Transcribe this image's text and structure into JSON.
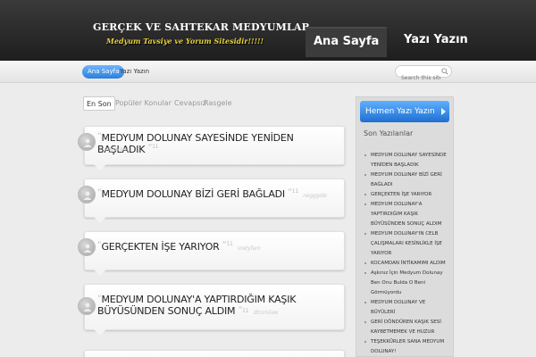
{
  "header": {
    "site_title": "GERÇEK VE SAHTEKAR MEDYUMLAR",
    "tagline": "Medyum Tavsiye ve Yorum Sitesidir!!!!!",
    "nav": [
      {
        "label": "Ana Sayfa",
        "active": true
      },
      {
        "label": "Yazı Yazın",
        "active": false
      }
    ]
  },
  "breadcrumb": {
    "home_label": "Ana Sayfa",
    "current_label": "Yazı Yazın"
  },
  "search": {
    "placeholder": "Search this site..."
  },
  "tabs": [
    {
      "label": "En Son",
      "active": true
    },
    {
      "label": "Popüler Konular",
      "active": false
    },
    {
      "label": "Cevapsız",
      "active": false
    },
    {
      "label": "Rasgele",
      "active": false
    }
  ],
  "posts": [
    {
      "title": "MEDYUM DOLUNAY SAYESİNDE YENİDEN BAŞLADIK",
      "count": "11",
      "author": "edevreet"
    },
    {
      "title": "MEDYUM DOLUNAY BİZİ GERİ BAĞLADI",
      "count": "11",
      "author": "negggide"
    },
    {
      "title": "GERÇEKTEN İŞE YARIYOR",
      "count": "11",
      "author": "vretyfam"
    },
    {
      "title_line1": "MEDYUM DOLUNAY'A YAPTIRDIĞIM KAŞIK",
      "title_line2": "BÜYÜSÜNDEN SONUÇ ALDIM",
      "count": "11",
      "author": "dtrsmilaw"
    }
  ],
  "sidebar": {
    "cta_label": "Hemen Yazı Yazın",
    "heading": "Son Yazılanlar",
    "recent": [
      [
        "MEDYUM DOLUNAY SAYESİNDE",
        "YENİDEN BAŞLADIK"
      ],
      [
        "MEDYUM DOLUNAY BİZİ GERİ",
        "BAĞLADI"
      ],
      [
        "GERÇEKTEN İŞE YARIYOR"
      ],
      [
        "MEDYUM DOLUNAY'A",
        "YAPTIRDIĞIM KAŞIK",
        "BÜYÜSÜNDEN SONUÇ ALDIM"
      ],
      [
        "MEDYUM DOLUNAY'IN CELB",
        "ÇALIŞMALARI KESİNLİKLE İŞE",
        "YARIYOR"
      ],
      [
        "KOCAMDAN İNTİKAMIMI ALDIM"
      ],
      [
        "Aşkınız İçin Medyum Dolunay",
        "Ben Onu Bulda O Beni",
        "Görmüyordu"
      ],
      [
        "MEDYUM DOLUNAY VE",
        "BÜYÜLERİ"
      ],
      [
        "GERİ DÖNDÜREN KAŞIK SESİ",
        "KAYBETMEMEK VE HUZUR"
      ],
      [
        "TEŞEKKÜRLER SANA MEDYUM",
        "DOLUNAY!"
      ]
    ]
  }
}
